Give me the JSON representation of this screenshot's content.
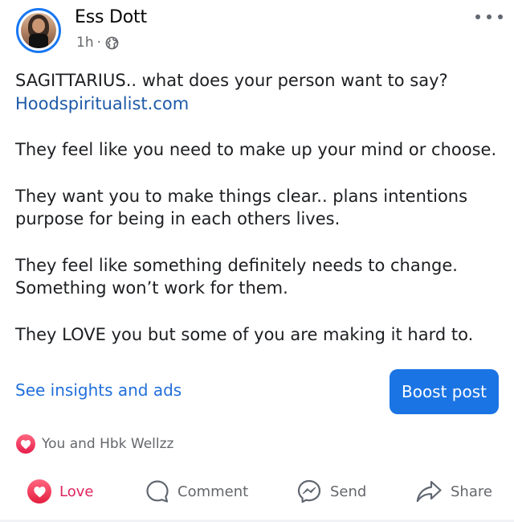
{
  "post": {
    "author": "Ess Dott",
    "time": "1h",
    "separator": "·",
    "audience_icon": "globe-icon",
    "lines": [
      "SAGITTARIUS.. what does your person want to say?",
      "Hoodspiritualist.com",
      "They feel like you need to make up your mind or choose.",
      "They want you to make things clear.. plans intentions purpose for being in each others lives.",
      "They feel like something definitely needs to change. Something won’t work for them.",
      "They LOVE you but some of you are making it hard to."
    ]
  },
  "insights": {
    "link_label": "See insights and ads",
    "boost_label": "Boost post"
  },
  "reactions": {
    "icon": "love-reaction-icon",
    "names": "You and Hbk Wellzz"
  },
  "actions": [
    {
      "label": "Love",
      "icon": "love-icon"
    },
    {
      "label": "Comment",
      "icon": "comment-icon"
    },
    {
      "label": "Send",
      "icon": "messenger-icon"
    },
    {
      "label": "Share",
      "icon": "share-icon"
    }
  ],
  "colors": {
    "accent": "#1b74e4",
    "link": "#216fdb",
    "love": "#e0245e",
    "muted": "#65676b"
  }
}
